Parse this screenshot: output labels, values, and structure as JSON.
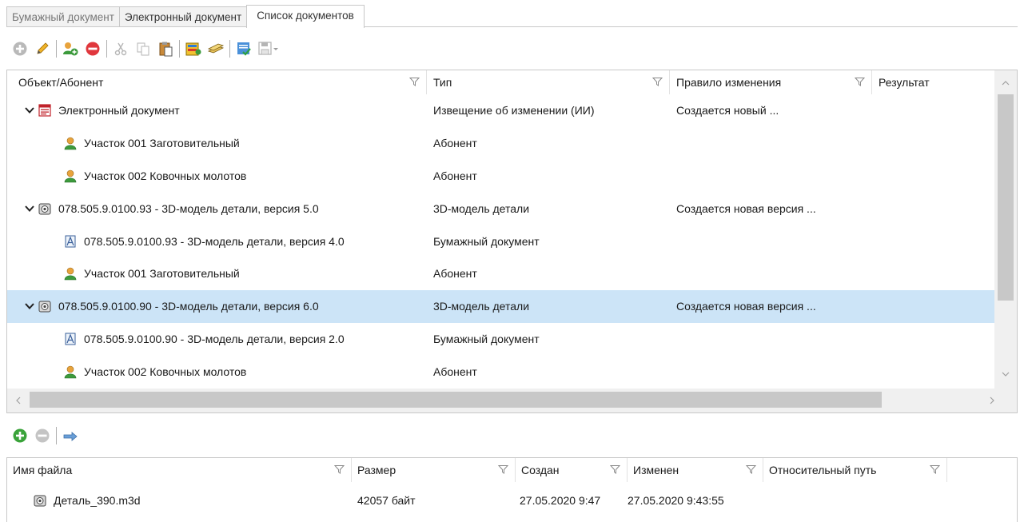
{
  "tabs": [
    "Бумажный документ",
    "Электронный документ",
    "Список документов"
  ],
  "columns": [
    "Объект/Абонент",
    "Тип",
    "Правило изменения",
    "Результат"
  ],
  "rows": [
    {
      "level": 0,
      "expander": true,
      "icon": "electronic-document-icon",
      "name": "Электронный документ",
      "type": "Извещение об изменении (ИИ)",
      "rule": "Создается новый ...",
      "result": ""
    },
    {
      "level": 1,
      "expander": false,
      "icon": "subscriber-icon",
      "name": "Участок 001 Заготовительный",
      "type": "Абонент",
      "rule": "",
      "result": ""
    },
    {
      "level": 1,
      "expander": false,
      "icon": "subscriber-icon",
      "name": "Участок 002 Ковочных молотов",
      "type": "Абонент",
      "rule": "",
      "result": ""
    },
    {
      "level": 0,
      "expander": true,
      "icon": "3d-model-icon",
      "name": "078.505.9.0100.93 - 3D-модель детали, версия 5.0",
      "type": "3D-модель детали",
      "rule": "Создается новая версия ...",
      "result": ""
    },
    {
      "level": 1,
      "expander": false,
      "icon": "paper-document-icon",
      "name": "078.505.9.0100.93 - 3D-модель детали, версия 4.0",
      "type": "Бумажный документ",
      "rule": "",
      "result": ""
    },
    {
      "level": 1,
      "expander": false,
      "icon": "subscriber-icon",
      "name": "Участок 001 Заготовительный",
      "type": "Абонент",
      "rule": "",
      "result": ""
    },
    {
      "level": 0,
      "expander": true,
      "icon": "3d-model-icon",
      "name": "078.505.9.0100.90 - 3D-модель детали, версия 6.0",
      "type": "3D-модель детали",
      "rule": "Создается новая версия ...",
      "result": "",
      "selected": true
    },
    {
      "level": 1,
      "expander": false,
      "icon": "paper-document-icon",
      "name": "078.505.9.0100.90 - 3D-модель детали, версия 2.0",
      "type": "Бумажный документ",
      "rule": "",
      "result": ""
    },
    {
      "level": 1,
      "expander": false,
      "icon": "subscriber-icon",
      "name": "Участок 002 Ковочных молотов",
      "type": "Абонент",
      "rule": "",
      "result": ""
    }
  ],
  "file_columns": [
    "Имя файла",
    "Размер",
    "Создан",
    "Изменен",
    "Относительный путь"
  ],
  "files": [
    {
      "icon": "3d-model-icon",
      "name": "Деталь_390.m3d",
      "size": "42057 байт",
      "created": "27.05.2020 9:47",
      "modified": "27.05.2020 9:43:55",
      "path": ""
    }
  ],
  "colors": {
    "selection": "#cce4f7",
    "border": "#c8c8c8",
    "scroll_thumb": "#c8c8c8"
  }
}
